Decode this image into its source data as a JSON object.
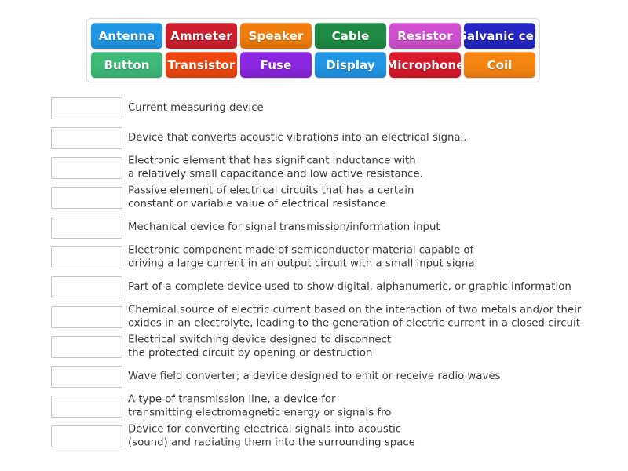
{
  "word_bank": {
    "rows": [
      [
        {
          "label": "Antenna",
          "color": "#2196e3"
        },
        {
          "label": "Ammeter",
          "color": "#ce1f2d"
        },
        {
          "label": "Speaker",
          "color": "#f07d0d"
        },
        {
          "label": "Cable",
          "color": "#1e8a45"
        },
        {
          "label": "Resistor",
          "color": "#d04fd0"
        },
        {
          "label": "Galvanic cell",
          "color": "#2526c4"
        }
      ],
      [
        {
          "label": "Button",
          "color": "#3fb97a"
        },
        {
          "label": "Transistor",
          "color": "#ef4711"
        },
        {
          "label": "Fuse",
          "color": "#8b26e0"
        },
        {
          "label": "Display",
          "color": "#2196e3"
        },
        {
          "label": "Microphone",
          "color": "#d91a2a"
        },
        {
          "label": "Coil",
          "color": "#f58410"
        }
      ]
    ]
  },
  "definitions": [
    {
      "text": "Current measuring device"
    },
    {
      "text": "Device that converts acoustic vibrations into an electrical signal."
    },
    {
      "text": "Electronic element that has significant inductance with\na relatively small capacitance and low active resistance."
    },
    {
      "text": "Passive element of electrical circuits that has a certain\nconstant or variable value of electrical resistance"
    },
    {
      "text": "Mechanical device for signal transmission/information input"
    },
    {
      "text": "Electronic component made of semiconductor material capable of\ndriving a large current in an output circuit with a small input signal"
    },
    {
      "text": "Part of a complete device used to show digital, alphanumeric, or graphic information"
    },
    {
      "text": "Chemical source of electric current based on the interaction of two metals and/or their\noxides in an electrolyte, leading to the generation of electric current in a closed circuit"
    },
    {
      "text": "Electrical switching device designed to disconnect\nthe protected circuit by opening or destruction"
    },
    {
      "text": "Wave field converter; a device designed to emit or receive radio waves"
    },
    {
      "text": "A type of transmission line, a device for\ntransmitting electromagnetic energy or signals fro"
    },
    {
      "text": "Device for converting electrical signals into acoustic\n(sound) and radiating them into the surrounding space"
    }
  ]
}
